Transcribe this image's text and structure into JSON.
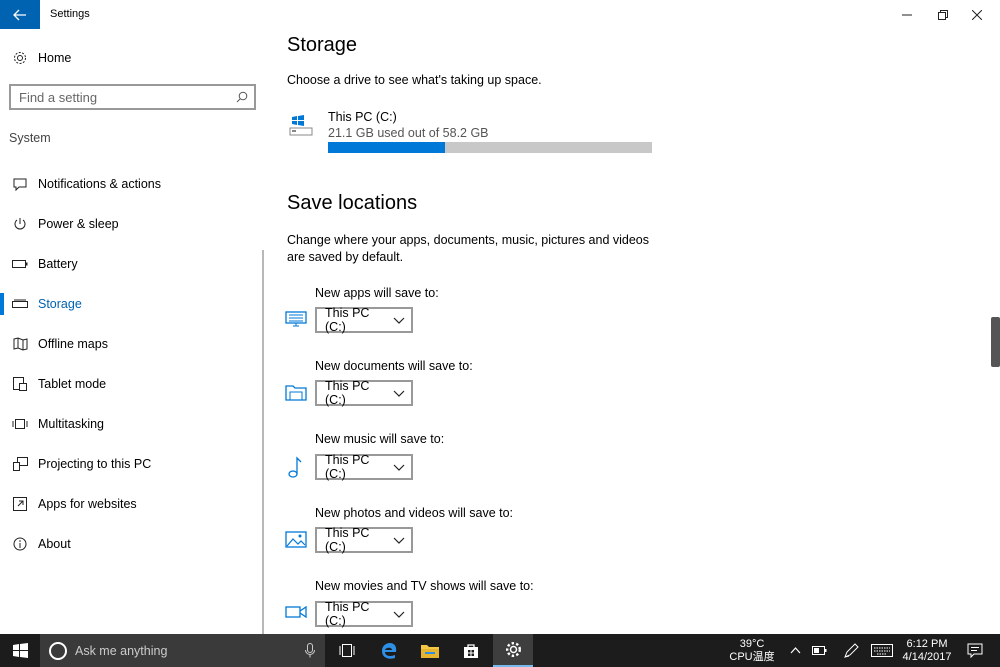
{
  "window": {
    "title": "Settings",
    "back_icon": "back-arrow-icon",
    "controls": [
      "minimize-icon",
      "restore-icon",
      "close-icon"
    ]
  },
  "sidebar": {
    "home_label": "Home",
    "search_placeholder": "Find a setting",
    "section_label": "System",
    "items": [
      {
        "label": "Notifications & actions",
        "icon": "notification-icon"
      },
      {
        "label": "Power & sleep",
        "icon": "power-icon"
      },
      {
        "label": "Battery",
        "icon": "battery-icon"
      },
      {
        "label": "Storage",
        "icon": "storage-icon",
        "active": true
      },
      {
        "label": "Offline maps",
        "icon": "map-icon"
      },
      {
        "label": "Tablet mode",
        "icon": "tablet-icon"
      },
      {
        "label": "Multitasking",
        "icon": "multitasking-icon"
      },
      {
        "label": "Projecting to this PC",
        "icon": "projecting-icon"
      },
      {
        "label": "Apps for websites",
        "icon": "apps-websites-icon"
      },
      {
        "label": "About",
        "icon": "info-icon"
      }
    ],
    "accent_color": "#0078d7"
  },
  "storage": {
    "title": "Storage",
    "description": "Choose a drive to see what's taking up space.",
    "drive": {
      "name": "This PC (C:)",
      "usage_text": "21.1 GB used out of 58.2 GB",
      "used_gb": 21.1,
      "total_gb": 58.2
    }
  },
  "save_locations": {
    "title": "Save locations",
    "description": "Change where your apps, documents, music, pictures and videos are saved by default.",
    "items": [
      {
        "label": "New apps will save to:",
        "value": "This PC (C:)",
        "icon": "monitor-icon"
      },
      {
        "label": "New documents will save to:",
        "value": "This PC (C:)",
        "icon": "folder-icon"
      },
      {
        "label": "New music will save to:",
        "value": "This PC (C:)",
        "icon": "music-note-icon"
      },
      {
        "label": "New photos and videos will save to:",
        "value": "This PC (C:)",
        "icon": "photo-icon"
      },
      {
        "label": "New movies and TV shows will save to:",
        "value": "This PC (C:)",
        "icon": "video-camera-icon"
      }
    ]
  },
  "taskbar": {
    "search_placeholder": "Ask me anything",
    "temperature": "39°C",
    "temperature_label": "CPU温度",
    "time": "6:12 PM",
    "date": "4/14/2017",
    "colors": {
      "background": "#1c1c1c",
      "search_box": "#3a3a3a"
    }
  }
}
